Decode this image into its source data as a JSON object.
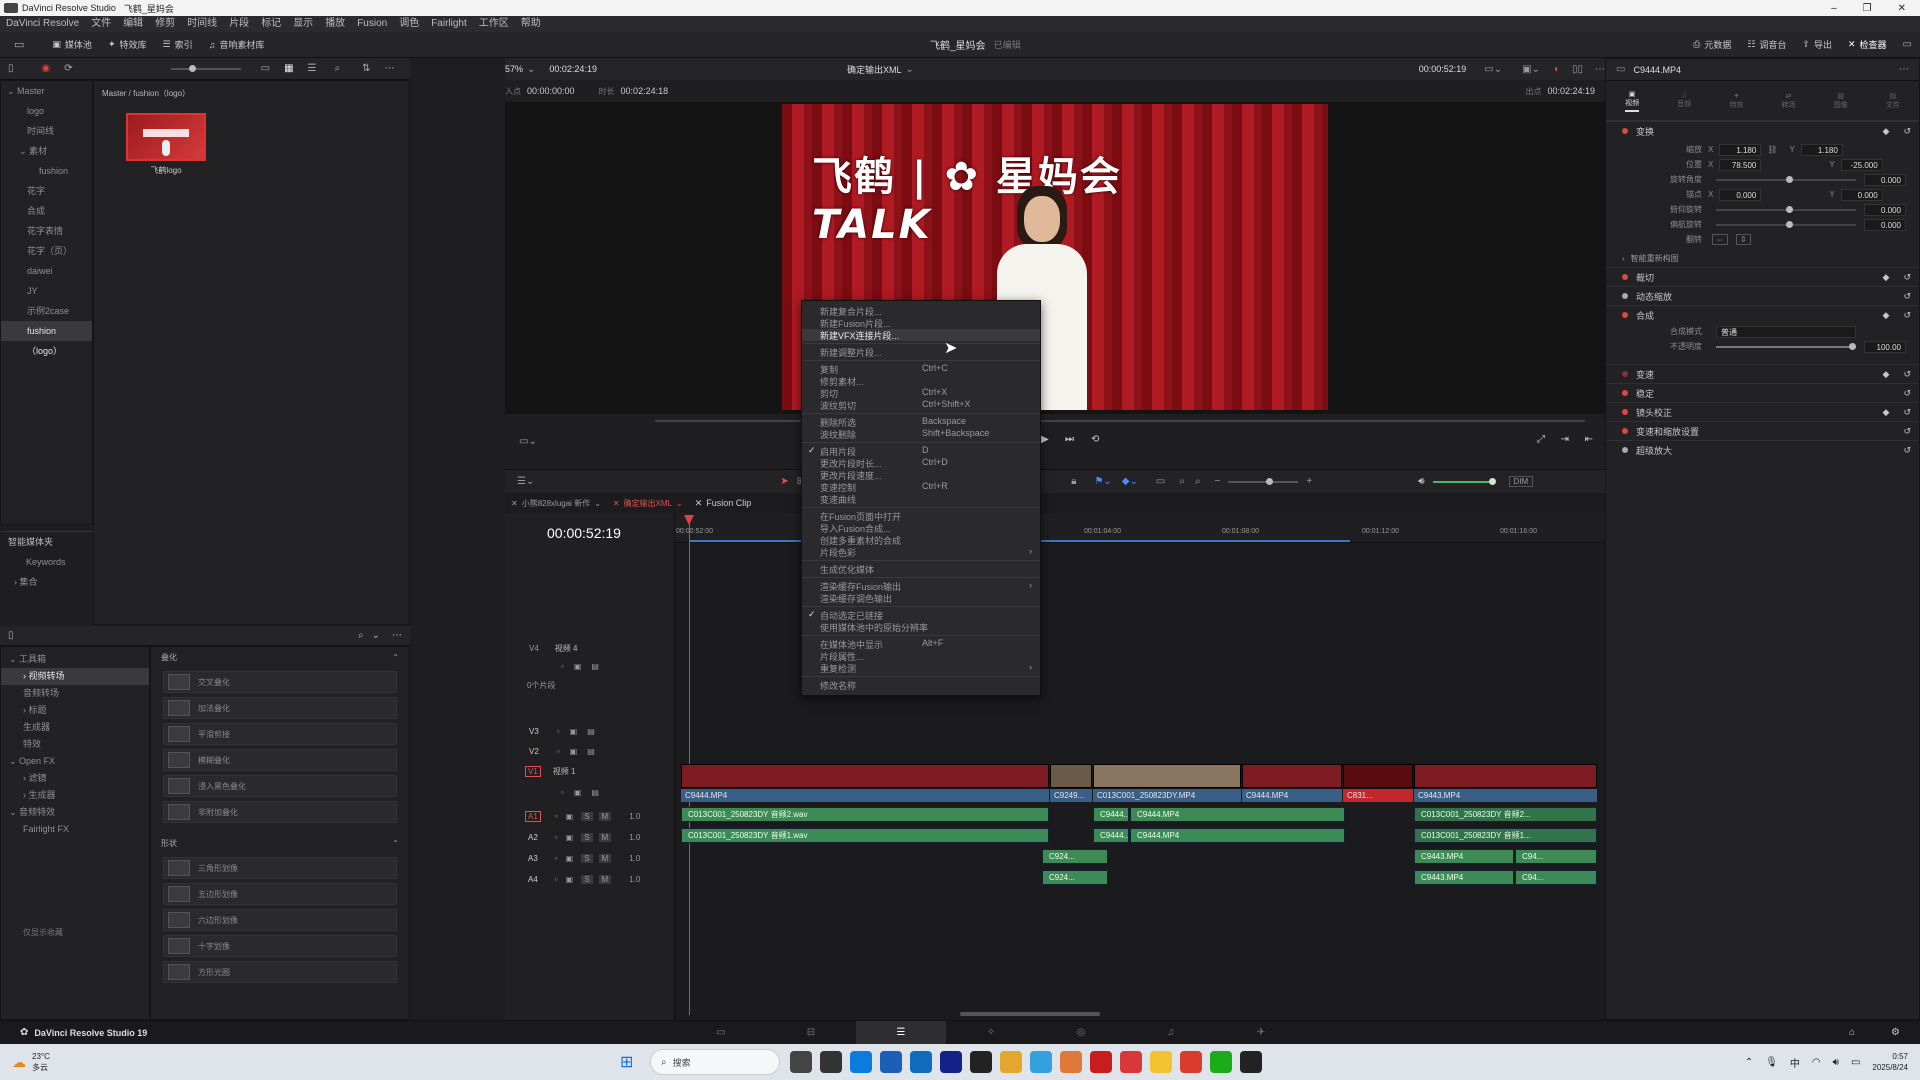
{
  "titlebar": {
    "app": "DaVinci Resolve Studio",
    "doc": "飞鹤_星妈会"
  },
  "menubar": [
    "DaVinci Resolve",
    "文件",
    "编辑",
    "修剪",
    "时间线",
    "片段",
    "标记",
    "显示",
    "播放",
    "Fusion",
    "调色",
    "Fairlight",
    "工作区",
    "帮助"
  ],
  "toolbar": {
    "media_pool": "媒体池",
    "effects": "特效库",
    "index": "索引",
    "sound_library": "音响素材库",
    "project": "飞鹤_星妈会",
    "project_state": "已编辑",
    "metadata": "元数据",
    "mixer": "调音台",
    "inspector": "检查器",
    "meta2": "导出",
    "render": "元数据"
  },
  "viewer": {
    "zoom": "57%",
    "timecode": "00:02:24:19",
    "timeline_name": "确定输出XML",
    "in_label": "入点",
    "in_tc": "00:00:00:00",
    "dur_label": "时长",
    "dur_tc": "00:02:24:18",
    "out_label": "出点",
    "out_tc": "00:02:24:19",
    "right_tc": "00:00:52:19",
    "clip_name": "C9444.MP4",
    "dim": "DIM"
  },
  "media": {
    "path": "Master / fushion（logo）",
    "thumb_label": "飞鹤logo",
    "bins": [
      "Master",
      "logo",
      "时间线",
      "素材",
      "fushion",
      "花字",
      "合成",
      "花字表情",
      "花字（页）",
      "daiwei",
      "JY",
      "示例2case",
      "fushion（logo）"
    ],
    "smart_bins": "智能媒体夹",
    "keywords": "Keywords",
    "collections": "集合"
  },
  "effects": {
    "tree": [
      "工具箱",
      "视频转场",
      "音频转场",
      "标题",
      "生成器",
      "特效",
      "Open FX",
      "滤镜",
      "生成器",
      "音频特效",
      "Fairlight FX"
    ],
    "favorites": "仅显示收藏",
    "group1": "叠化",
    "fx1": [
      "交叉叠化",
      "加法叠化",
      "平滑剪接",
      "模糊叠化",
      "浸入黑色叠化",
      "非附加叠化"
    ],
    "group2": "形状",
    "fx2": [
      "三角形划像",
      "五边形划像",
      "六边形划像",
      "十字划像",
      "方形光圈"
    ]
  },
  "inspector": {
    "transform": "变换",
    "zoom": "缩放",
    "pos": "位置",
    "rotate": "旋转角度",
    "anchor": "锚点",
    "pitch": "俯仰旋转",
    "yaw": "偏航旋转",
    "flip": "翻转",
    "zoom_x": "1.180",
    "zoom_y": "1.180",
    "pos_x": "78.500",
    "pos_y": "-25.000",
    "rot": "0.000",
    "anch_x": "0.000",
    "anch_y": "0.000",
    "pitch_v": "0.000",
    "yaw_v": "0.000",
    "smart": "智能重新构图",
    "crop": "裁切",
    "dyn_zoom": "动态缩放",
    "comp": "合成",
    "comp_mode_label": "合成模式",
    "comp_mode": "普通",
    "opacity_label": "不透明度",
    "opacity": "100.00",
    "speed": "变速",
    "stabilize": "稳定",
    "lens": "镜头校正",
    "retime": "变速和缩放设置",
    "super": "超级放大",
    "tabs": [
      "视频",
      "音频",
      "特效",
      "转场",
      "图像",
      "文件"
    ]
  },
  "timeline": {
    "tc": "00:00:52:19",
    "tabs": [
      "小熊828xlugai 新作",
      "确定输出XML",
      "Fusion Clip"
    ],
    "ruler": [
      "00:00:52:00",
      "00:01:04:00",
      "00:01:08:00",
      "00:01:12:00",
      "00:01:16:00"
    ],
    "tracks": {
      "v4": "V4",
      "v4n": "视频 4",
      "clips0": "0个片段",
      "v3": "V3",
      "v2": "V2",
      "v1": "V1",
      "v1n": "视频 1",
      "a1": "A1",
      "a2": "A2",
      "a3": "A3",
      "a4": "A4",
      "vol": "1.0"
    },
    "clips": {
      "c1": "C9444.MP4",
      "c2": "C9249...",
      "c3": "C013C001_250823DY.MP4",
      "c4": "C9444.MP4",
      "c5": "C831...",
      "c6": "C9443.MP4",
      "a1a": "C013C001_250823DY 音频2.wav",
      "a1b": "C9444...",
      "a1c": "C9444.MP4",
      "a1d": "C013C001_250823DY 音频2...",
      "a2a": "C013C001_250823DY 音频1.wav",
      "a2b": "C9444...",
      "a2c": "C9444.MP4",
      "a2d": "C013C001_250823DY 音频1...",
      "a3a": "C924...",
      "a3b": "C9443.MP4",
      "a3c": "C94...",
      "a4a": "C924...",
      "a4b": "C9443.MP4",
      "a4c": "C94..."
    }
  },
  "context_menu": [
    {
      "t": "新建复合片段..."
    },
    {
      "t": "新建Fusion片段..."
    },
    {
      "t": "新建VFX连接片段...",
      "hl": true
    },
    {
      "sep": true
    },
    {
      "t": "新建调整片段..."
    },
    {
      "sep": true
    },
    {
      "t": "复制",
      "k": "Ctrl+C"
    },
    {
      "t": "修剪素材..."
    },
    {
      "t": "剪切",
      "k": "Ctrl+X"
    },
    {
      "t": "波纹剪切",
      "k": "Ctrl+Shift+X"
    },
    {
      "sep": true
    },
    {
      "t": "删除所选",
      "k": "Backspace"
    },
    {
      "t": "波纹删除",
      "k": "Shift+Backspace"
    },
    {
      "sep": true
    },
    {
      "t": "启用片段",
      "k": "D",
      "chk": true
    },
    {
      "t": "更改片段时长...",
      "k": "Ctrl+D"
    },
    {
      "t": "更改片段速度..."
    },
    {
      "t": "变速控制",
      "k": "Ctrl+R"
    },
    {
      "t": "变速曲线"
    },
    {
      "sep": true
    },
    {
      "t": "在Fusion页面中打开"
    },
    {
      "t": "导入Fusion合成..."
    },
    {
      "t": "创建多重素材的合成"
    },
    {
      "t": "片段色彩",
      "sub": true
    },
    {
      "sep": true
    },
    {
      "t": "生成优化媒体"
    },
    {
      "sep": true
    },
    {
      "t": "渲染缓存Fusion输出",
      "sub": true
    },
    {
      "t": "渲染缓存调色输出"
    },
    {
      "sep": true
    },
    {
      "t": "自动选定已链接",
      "chk": true
    },
    {
      "t": "使用媒体池中的原始分辨率"
    },
    {
      "sep": true
    },
    {
      "t": "在媒体池中显示",
      "k": "Alt+F"
    },
    {
      "t": "片段属性..."
    },
    {
      "t": "重复检测",
      "sub": true
    },
    {
      "sep": true
    },
    {
      "t": "修改名称"
    }
  ],
  "pages": [
    "媒体",
    "快编",
    "剪辑",
    "Fusion",
    "调色",
    "Fairlight",
    "交付"
  ],
  "app_version": "DaVinci Resolve Studio 19",
  "taskbar": {
    "weather_temp": "23°C",
    "weather_desc": "多云",
    "search": "搜索",
    "time": "0:57",
    "date": "2025/8/24"
  }
}
